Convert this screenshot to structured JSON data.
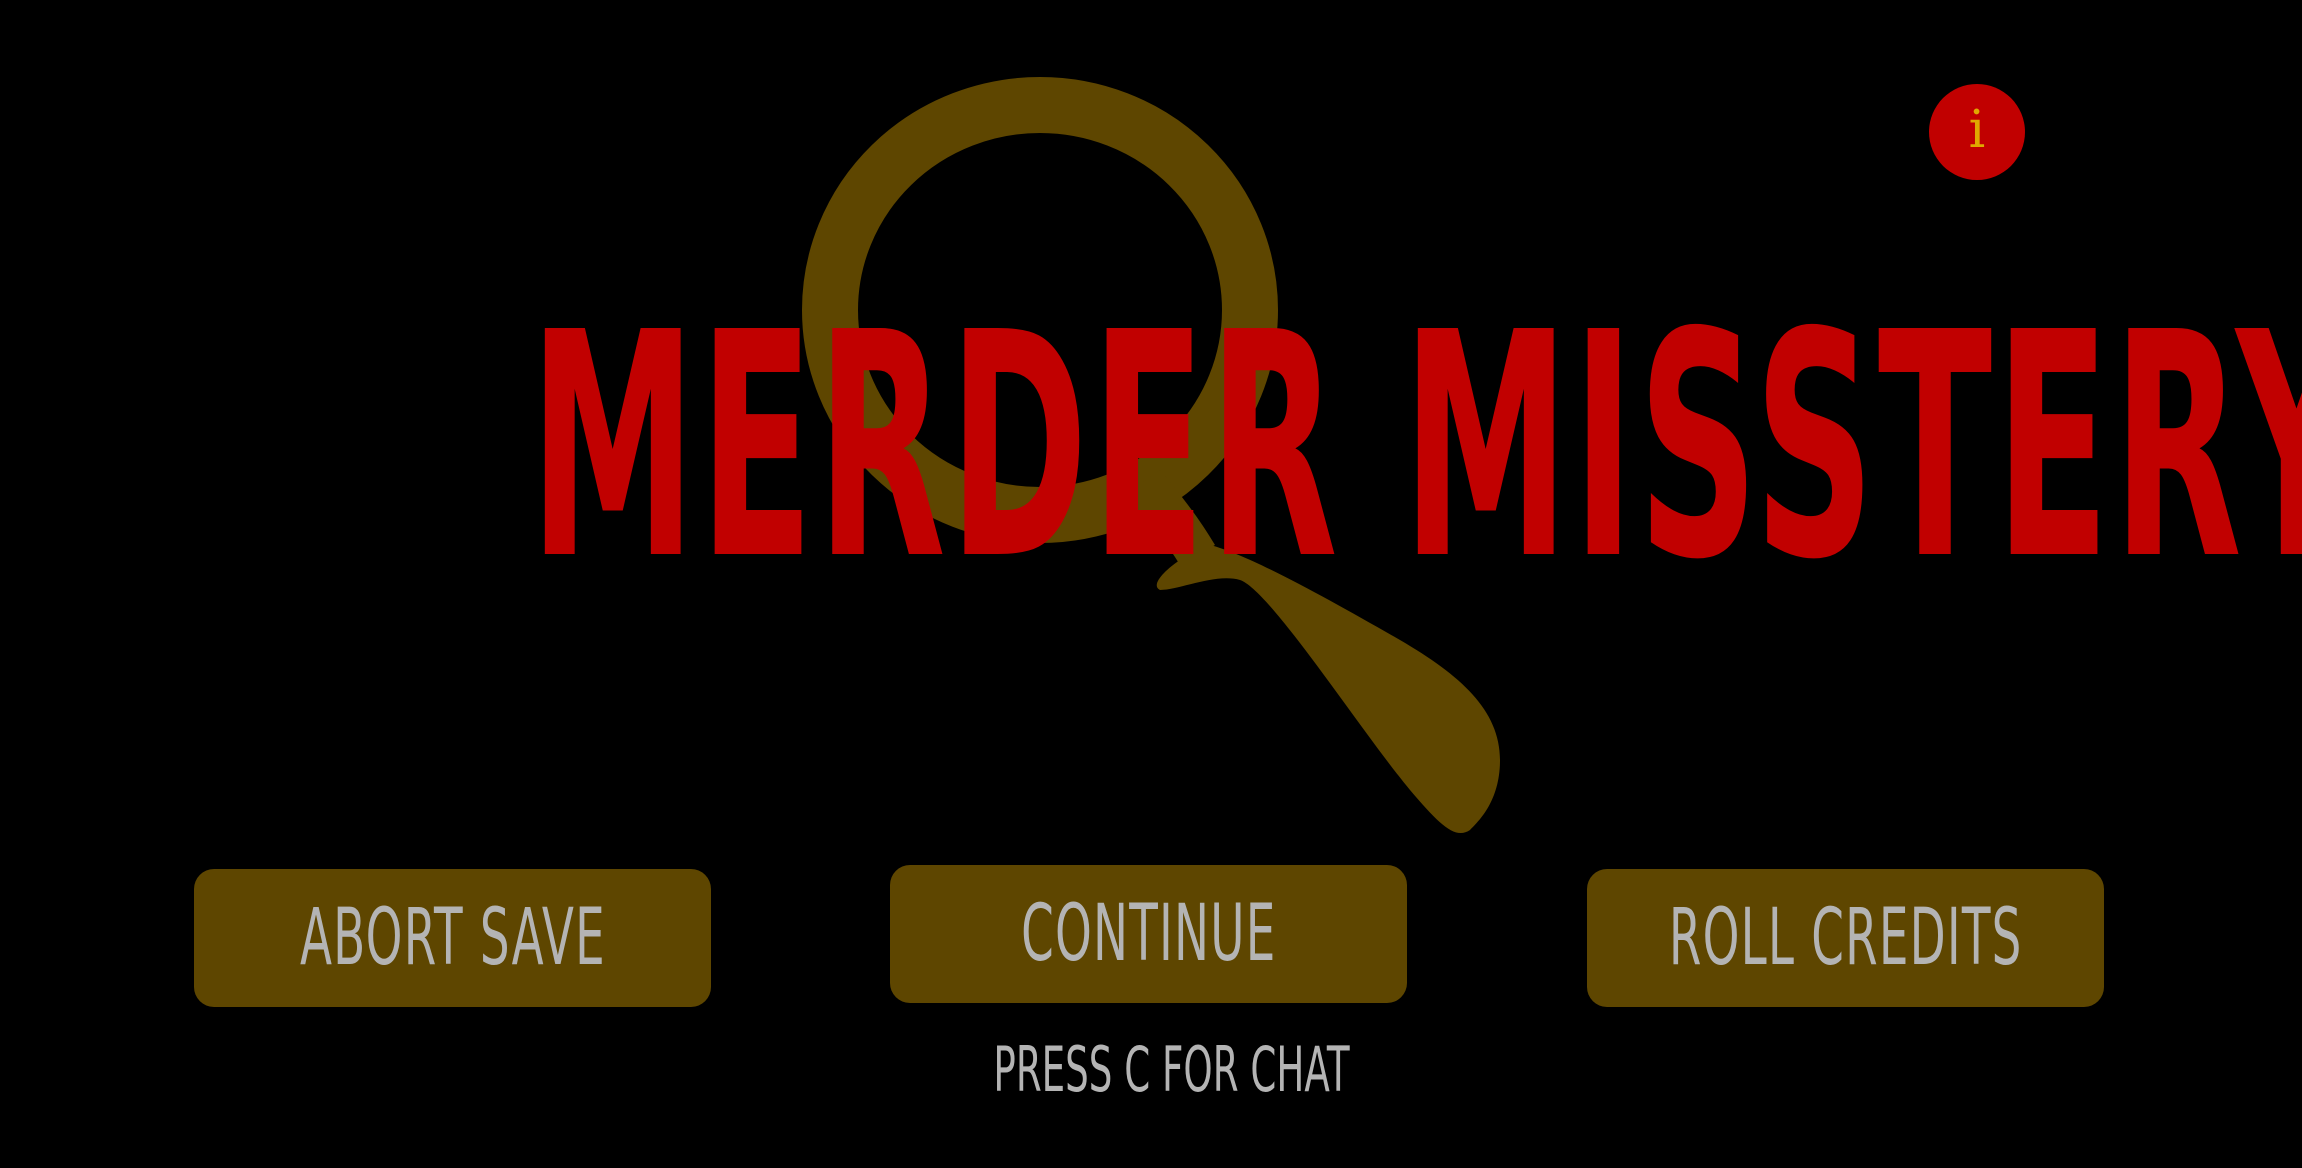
{
  "title": "MERDER MISSTERY",
  "info_button": {
    "glyph": "i",
    "icon": "info-icon"
  },
  "menu": {
    "abort_save_label": "ABORT SAVE",
    "continue_label": "CONTINUE",
    "roll_credits_label": "ROLL CREDITS"
  },
  "hint": "PRESS C FOR CHAT",
  "colors": {
    "background": "#000000",
    "title": "#c10000",
    "button_fill": "#5e4600",
    "button_text": "#b4b4b4",
    "magnifier": "#5e4600",
    "info_fill": "#c10000",
    "info_glyph": "#e0a800"
  },
  "decor": {
    "logo_icon": "magnifying-glass-icon"
  }
}
